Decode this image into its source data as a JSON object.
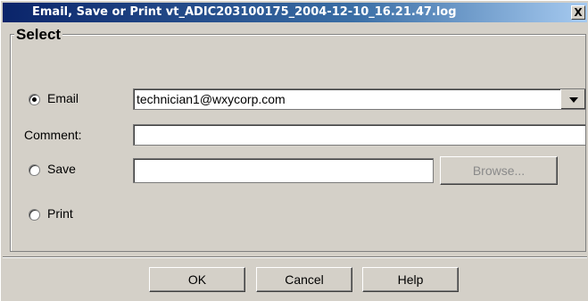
{
  "window": {
    "title": "Email, Save or Print vt_ADIC203100175_2004-12-10_16.21.47.log",
    "close_label": "X"
  },
  "group": {
    "legend": "Select"
  },
  "options": {
    "email_label": "Email",
    "email_selected": true,
    "comment_label": "Comment:",
    "save_label": "Save",
    "save_selected": false,
    "print_label": "Print",
    "print_selected": false
  },
  "fields": {
    "email_value": "technician1@wxycorp.com",
    "comment_value": "",
    "save_path_value": "",
    "browse_label": "Browse..."
  },
  "buttons": {
    "ok_label": "OK",
    "cancel_label": "Cancel",
    "help_label": "Help"
  },
  "colors": {
    "titlebar_start": "#0a246a",
    "titlebar_end": "#a6caf0",
    "window_bg": "#d4d0c8"
  },
  "icons": {
    "close": "close-icon",
    "dropdown": "chevron-down-icon"
  }
}
